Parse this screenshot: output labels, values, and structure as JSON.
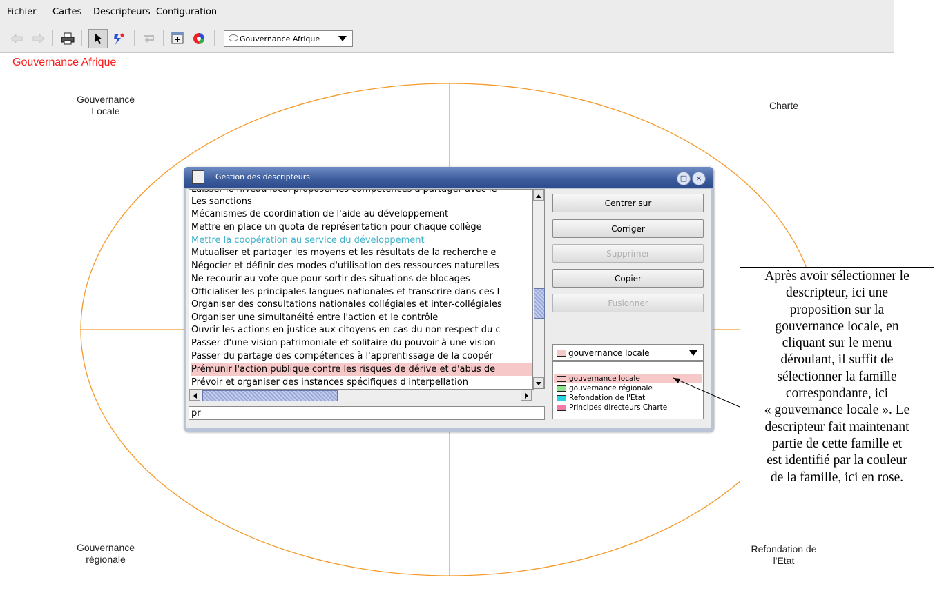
{
  "menubar": {
    "items": [
      "Fichier",
      "Cartes",
      "Descripteurs",
      "Configuration"
    ]
  },
  "toolbar": {
    "icons": [
      "back-arrow-icon",
      "forward-arrow-icon",
      "printer-icon",
      "pointer-icon",
      "magic-link-icon",
      "return-icon",
      "add-descriptor-icon",
      "color-wheel-icon"
    ],
    "map_selector": "Gouvernance Afrique"
  },
  "map": {
    "title": "Gouvernance Afrique",
    "title_color": "#ff1a1a",
    "ellipse_color": "#f59a2a",
    "quadrants": {
      "top_left": [
        "Gouvernance",
        "Locale"
      ],
      "top_right": [
        "Charte"
      ],
      "bottom_left": [
        "Gouvernance",
        "régionale"
      ],
      "bottom_right": [
        "Refondation de",
        "l'Etat"
      ]
    }
  },
  "dialog": {
    "title": "Gestion des descripteurs",
    "list_items": [
      {
        "text": "Laisser le niveau local proposer les compétences à partager avec le",
        "state": "partial"
      },
      {
        "text": "Les sanctions",
        "state": "normal"
      },
      {
        "text": "Mécanismes de coordination de l'aide au développement",
        "state": "normal"
      },
      {
        "text": "Mettre en place un quota de représentation pour chaque collège",
        "state": "normal"
      },
      {
        "text": "Mettre la coopération au service du développement",
        "state": "blue"
      },
      {
        "text": "Mutualiser et partager  les moyens et les résultats de la recherche e",
        "state": "normal"
      },
      {
        "text": "Négocier et définir des modes d'utilisation des ressources naturelles",
        "state": "normal"
      },
      {
        "text": "Ne recourir au vote que pour sortir des situations de blocages",
        "state": "normal"
      },
      {
        "text": "Officialiser les principales langues nationales et transcrire dans ces l",
        "state": "normal"
      },
      {
        "text": "Organiser des consultations nationales collégiales et inter-collégiales",
        "state": "normal"
      },
      {
        "text": "Organiser une simultanéité entre l'action et le contrôle",
        "state": "normal"
      },
      {
        "text": "Ouvrir les actions en justice aux citoyens en cas du non respect du c",
        "state": "normal"
      },
      {
        "text": "Passer d'une vision patrimoniale et solitaire du pouvoir à une vision",
        "state": "normal"
      },
      {
        "text": "Passer du partage des compétences à l'apprentissage de la coopér",
        "state": "normal"
      },
      {
        "text": "Prémunir l'action publique contre les risques de dérive et d'abus de",
        "state": "selected"
      },
      {
        "text": "Prévoir et organiser des instances spécifiques d'interpellation",
        "state": "normal"
      }
    ],
    "filter_value": "pr",
    "buttons": {
      "center": "Centrer sur",
      "correct": "Corriger",
      "delete": "Supprimer",
      "copy": "Copier",
      "merge": "Fusionner"
    },
    "family_selected": "gouvernance locale",
    "families": [
      {
        "label": "gouvernance locale",
        "color": "#f6c8c8",
        "selected": true
      },
      {
        "label": "gouvernance régionale",
        "color": "#8fe08f",
        "selected": false
      },
      {
        "label": "Refondation de l'Etat",
        "color": "#26d4e6",
        "selected": false
      },
      {
        "label": "Principes directeurs Charte",
        "color": "#f27aa6",
        "selected": false
      }
    ],
    "selected_color": "#f6c8c8"
  },
  "annotation": {
    "lines": [
      "Après avoir sélectionner le",
      "descripteur, ici une",
      "proposition sur la",
      "gouvernance locale, en",
      "cliquant sur le menu",
      "déroulant, il suffit de",
      "sélectionner la famille",
      "correspondante, ici",
      "« gouvernance locale ». Le",
      "descripteur fait maintenant",
      "partie de cette famille et",
      "est identifié par la couleur",
      "de la famille, ici en rose."
    ]
  }
}
